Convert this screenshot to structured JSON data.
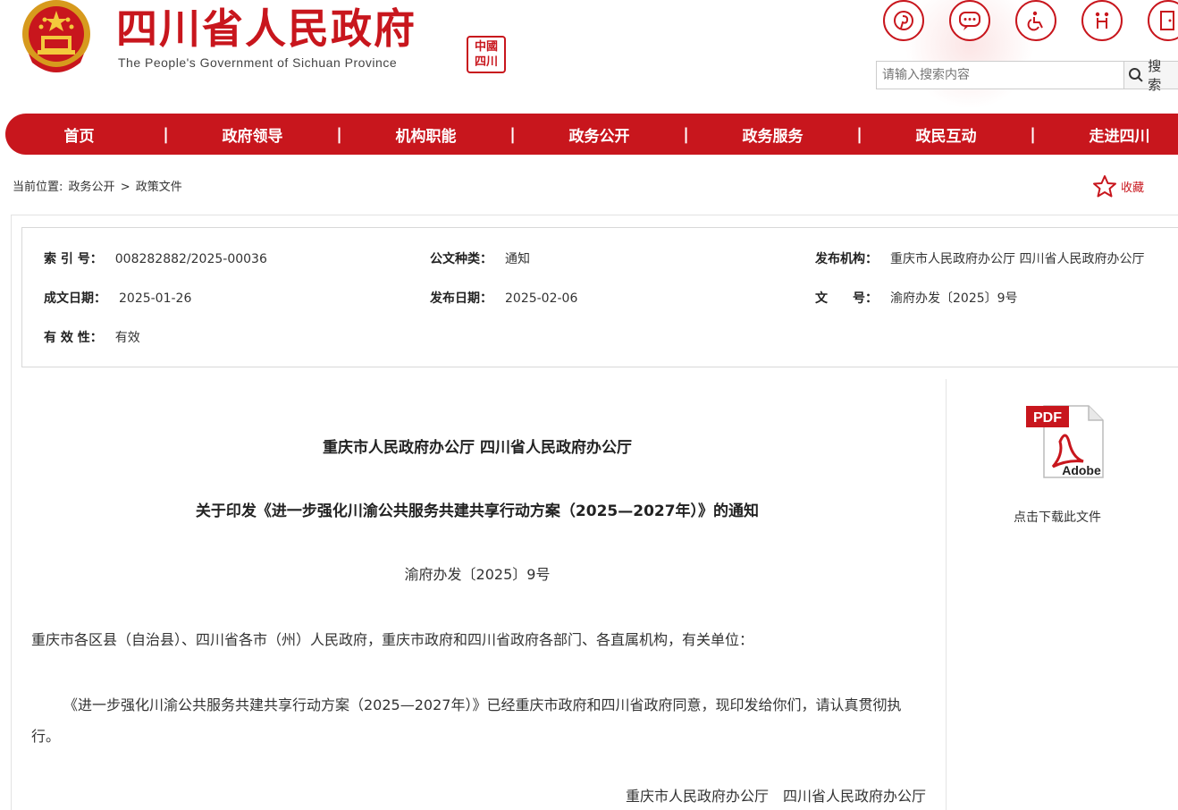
{
  "header": {
    "site_title": "四川省人民政府",
    "site_subtitle": "The People's Government of Sichuan Province",
    "seal_text": "中國四川",
    "top_icons": [
      "pinterest-icon",
      "chat-icon",
      "accessibility-icon",
      "elderly-care-icon",
      "exit-icon"
    ],
    "search": {
      "placeholder": "请输入搜索内容",
      "button_label": "搜 索"
    }
  },
  "nav": {
    "items": [
      "首页",
      "政府领导",
      "机构职能",
      "政务公开",
      "政务服务",
      "政民互动",
      "走进四川"
    ],
    "separator": "|"
  },
  "breadcrumb": {
    "prefix": "当前位置:",
    "items": [
      "政务公开",
      "政策文件"
    ],
    "separator": ">"
  },
  "favorite": {
    "label": "收藏"
  },
  "meta": {
    "index_no": {
      "label": "索 引 号：",
      "value": "008282882/2025-00036"
    },
    "doc_type": {
      "label": "公文种类：",
      "value": "通知"
    },
    "issuer": {
      "label": "发布机构：",
      "value": "重庆市人民政府办公厅 四川省人民政府办公厅"
    },
    "created": {
      "label": "成文日期：",
      "value": "2025-01-26"
    },
    "published": {
      "label": "发布日期：",
      "value": "2025-02-06"
    },
    "doc_no": {
      "label": "文　　号：",
      "value": "渝府办发〔2025〕9号"
    },
    "validity": {
      "label": "有 效 性：",
      "value": "有效"
    }
  },
  "article": {
    "issuer": "重庆市人民政府办公厅  四川省人民政府办公厅",
    "title": "关于印发《进一步强化川渝公共服务共建共享行动方案（2025—2027年）》的通知",
    "doc_no": "渝府办发〔2025〕9号",
    "addressees": "重庆市各区县（自治县）、四川省各市（州）人民政府，重庆市政府和四川省政府各部门、各直属机构，有关单位：",
    "body": "《进一步强化川渝公共服务共建共享行动方案（2025—2027年）》已经重庆市政府和四川省政府同意，现印发给你们，请认真贯彻执行。",
    "signature": "重庆市人民政府办公厅　四川省人民政府办公厅"
  },
  "download": {
    "pdf_badge": "PDF",
    "adobe_text": "Adobe",
    "label": "点击下载此文件"
  },
  "colors": {
    "brand_red": "#c8161d"
  }
}
